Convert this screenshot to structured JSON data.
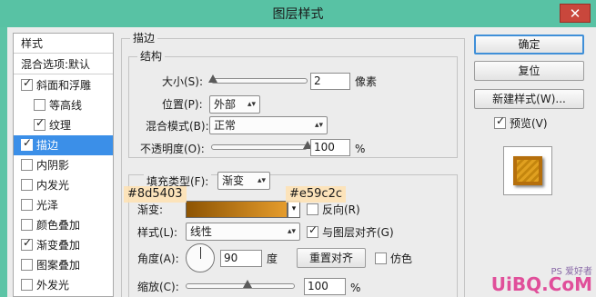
{
  "window": {
    "title": "图层样式",
    "close": "✕"
  },
  "left_list": {
    "header": "样式",
    "blend_options": "混合选项:默认",
    "items": [
      {
        "label": "斜面和浮雕",
        "checked": true
      },
      {
        "label": "等高线",
        "checked": false
      },
      {
        "label": "纹理",
        "checked": true
      },
      {
        "label": "描边",
        "checked": true,
        "selected": true
      },
      {
        "label": "内阴影",
        "checked": false
      },
      {
        "label": "内发光",
        "checked": false
      },
      {
        "label": "光泽",
        "checked": false
      },
      {
        "label": "颜色叠加",
        "checked": false
      },
      {
        "label": "渐变叠加",
        "checked": true
      },
      {
        "label": "图案叠加",
        "checked": false
      },
      {
        "label": "外发光",
        "checked": false
      }
    ]
  },
  "stroke": {
    "title": "描边",
    "structure": {
      "title": "结构",
      "size_label": "大小(S):",
      "size_value": "2",
      "size_unit": "像素",
      "size_level": 0.02,
      "position_label": "位置(P):",
      "position_value": "外部",
      "blend_label": "混合模式(B):",
      "blend_value": "正常",
      "opacity_label": "不透明度(O):",
      "opacity_value": "100",
      "opacity_unit": "%"
    },
    "fill": {
      "type_label": "填充类型(F):",
      "type_value": "渐变",
      "gradient_label": "渐变:",
      "gradient_start": "#8d5403",
      "gradient_end": "#e59c2c",
      "reverse_label": "反向(R)",
      "reverse_checked": false,
      "style_label": "样式(L):",
      "style_value": "线性",
      "align_label": "与图层对齐(G)",
      "align_checked": true,
      "angle_label": "角度(A):",
      "angle_value": "90",
      "angle_unit": "度",
      "reset_align": "重置对齐",
      "dither_label": "仿色",
      "dither_checked": false,
      "scale_label": "缩放(C):",
      "scale_value": "100",
      "scale_unit": "%"
    }
  },
  "buttons": {
    "ok": "确定",
    "reset": "复位",
    "new_style": "新建样式(W)...",
    "preview_label": "预览(V)",
    "preview_checked": true
  },
  "watermark": {
    "main": "UiBQ.CoM",
    "brand": "PS 爱好者"
  }
}
